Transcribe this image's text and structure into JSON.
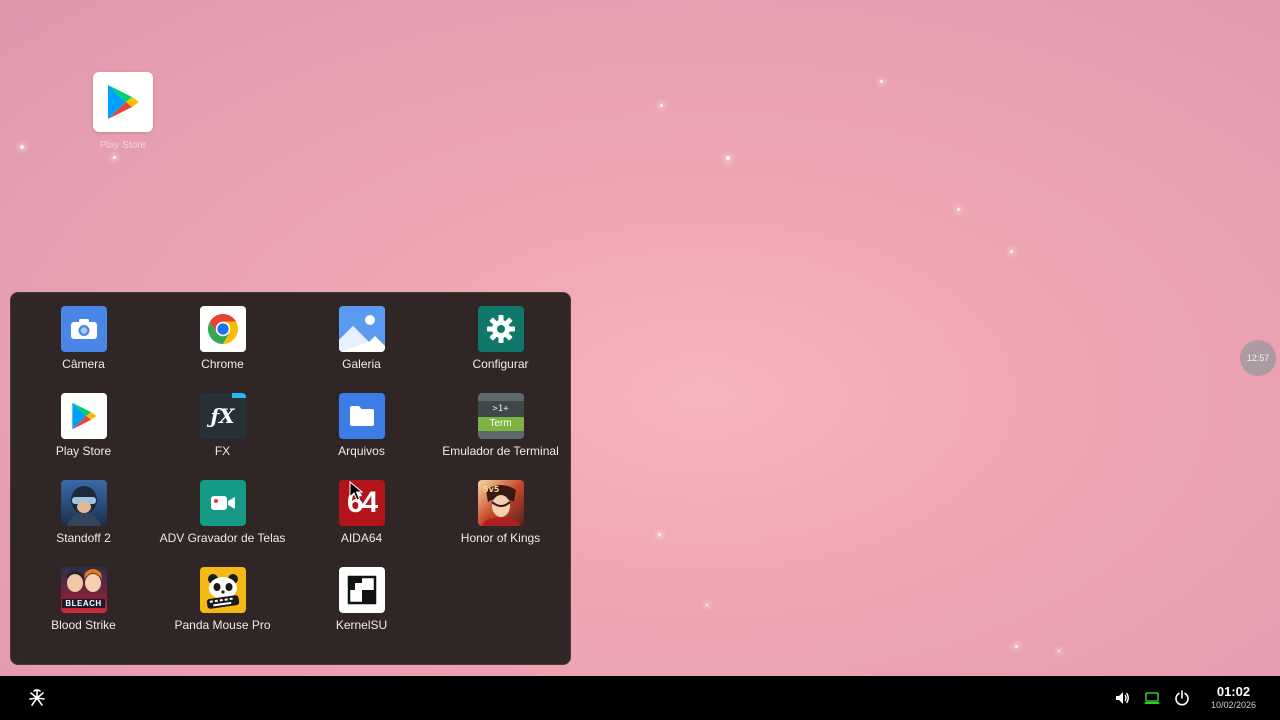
{
  "desktop": {
    "shortcut": {
      "label": "Play Store",
      "icon": "play-store-icon"
    }
  },
  "drawer": {
    "apps": [
      {
        "label": "Câmera",
        "icon": "camera-icon"
      },
      {
        "label": "Chrome",
        "icon": "chrome-icon"
      },
      {
        "label": "Galeria",
        "icon": "gallery-icon"
      },
      {
        "label": "Configurar",
        "icon": "settings-icon"
      },
      {
        "label": "Play Store",
        "icon": "play-store-icon"
      },
      {
        "label": "FX",
        "icon": "fx-icon",
        "badge": "ƒX"
      },
      {
        "label": "Arquivos",
        "icon": "files-icon"
      },
      {
        "label": "Emulador de Terminal",
        "icon": "terminal-icon",
        "badge_top": ">1+",
        "badge_bottom": "Term"
      },
      {
        "label": "Standoff 2",
        "icon": "standoff-icon"
      },
      {
        "label": "ADV Gravador de Telas",
        "icon": "screen-recorder-icon"
      },
      {
        "label": "AIDA64",
        "icon": "aida64-icon",
        "badge": "64"
      },
      {
        "label": "Honor of Kings",
        "icon": "honor-of-kings-icon"
      },
      {
        "label": "Blood Strike",
        "icon": "blood-strike-icon",
        "badge": "BLEACH"
      },
      {
        "label": "Panda Mouse Pro",
        "icon": "panda-mouse-icon"
      },
      {
        "label": "KernelSU",
        "icon": "kernelsu-icon"
      }
    ]
  },
  "floating_clock": {
    "time": "12:57"
  },
  "taskbar": {
    "start_icon": "start-menu-icon",
    "tray": [
      "volume-icon",
      "display-icon",
      "power-icon"
    ],
    "time": "01:02",
    "date": "10/02/2026"
  },
  "colors": {
    "drawer_bg": "#312626",
    "taskbar_bg": "#000000",
    "display_icon": "#38c438"
  }
}
